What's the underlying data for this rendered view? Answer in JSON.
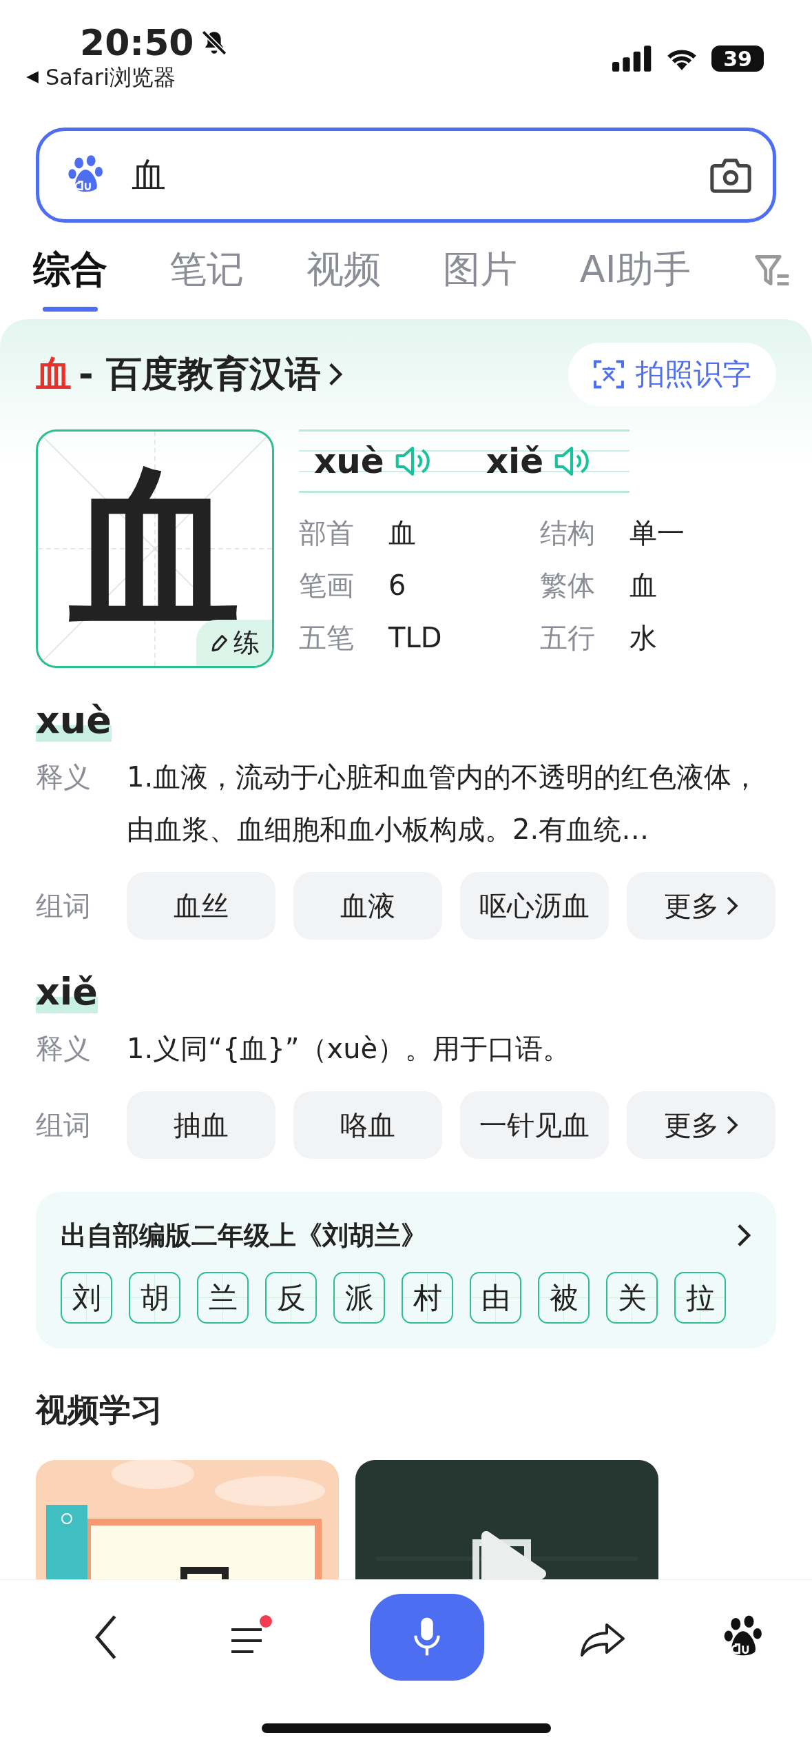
{
  "status_bar": {
    "time": "20:50",
    "back_app": "Safari浏览器",
    "battery": "39",
    "muted": true
  },
  "search": {
    "value": "血"
  },
  "tabs": [
    {
      "label": "综合",
      "selected": true
    },
    {
      "label": "笔记",
      "selected": false
    },
    {
      "label": "视频",
      "selected": false
    },
    {
      "label": "图片",
      "selected": false
    },
    {
      "label": "AI助手",
      "selected": false
    }
  ],
  "entry": {
    "char": "血",
    "stroke_char": "血",
    "source": "- 百度教育汉语",
    "photo_button": "拍照识字",
    "practice": "练",
    "pronunciations": [
      {
        "pinyin": "xuè"
      },
      {
        "pinyin": "xiě"
      }
    ],
    "attributes": [
      {
        "label": "部首",
        "value": "血"
      },
      {
        "label": "结构",
        "value": "单一"
      },
      {
        "label": "笔画",
        "value": "6"
      },
      {
        "label": "繁体",
        "value": "血"
      },
      {
        "label": "五笔",
        "value": "TLD"
      },
      {
        "label": "五行",
        "value": "水"
      }
    ]
  },
  "readings": [
    {
      "pinyin": "xuè",
      "definition_label": "释义",
      "definition": "1.血液，流动于心脏和血管内的不透明的红色液体，由血浆、血细胞和血小板构成。2.有血统…",
      "words_label": "组词",
      "words": [
        "血丝",
        "血液",
        "呕心沥血"
      ],
      "more": "更多"
    },
    {
      "pinyin": "xiě",
      "definition_label": "释义",
      "definition": "1.义同“{血}”（xuè）。用于口语。",
      "words_label": "组词",
      "words": [
        "抽血",
        "咯血",
        "一针见血"
      ],
      "more": "更多"
    }
  ],
  "textbook": {
    "title": "出自部编版二年级上《刘胡兰》",
    "chars": [
      "刘",
      "胡",
      "兰",
      "反",
      "派",
      "村",
      "由",
      "被",
      "关",
      "拉"
    ]
  },
  "videos": {
    "title": "视频学习"
  },
  "bottom_nav": {
    "menu_unread": true
  }
}
